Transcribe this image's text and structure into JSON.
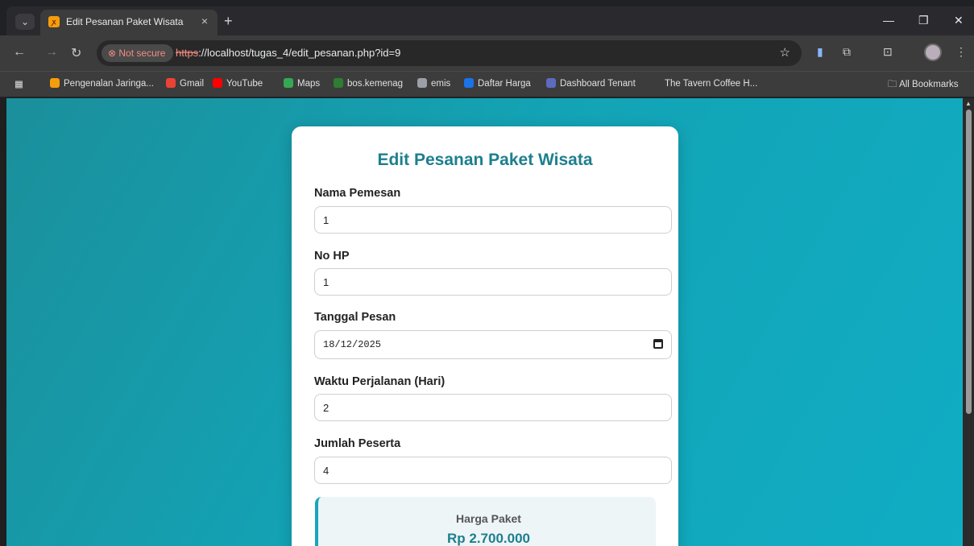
{
  "browser": {
    "tab_title": "Edit Pesanan Paket Wisata",
    "tab_close": "×",
    "new_tab": "+",
    "not_secure": "Not secure",
    "url_scheme": "https",
    "url_rest": "://localhost/tugas_4/edit_pesanan.php?id=9",
    "bookmarks": [
      {
        "label": "Pengenalan Jaringa...",
        "color": "#f59e0b"
      },
      {
        "label": "Gmail",
        "color": "#ea4335"
      },
      {
        "label": "YouTube",
        "color": "#ff0000"
      },
      {
        "label": "Maps",
        "color": "#34a853"
      },
      {
        "label": "bos.kemenag",
        "color": "#2e7d32"
      },
      {
        "label": "emis",
        "color": "#9aa0a6"
      },
      {
        "label": "Daftar Harga",
        "color": "#1a73e8"
      },
      {
        "label": "Dashboard Tenant",
        "color": "#5c6bc0"
      },
      {
        "label": "The Tavern Coffee H...",
        "color": "#3c3c3c"
      }
    ],
    "all_bookmarks": "All Bookmarks"
  },
  "form": {
    "title": "Edit Pesanan Paket Wisata",
    "fields": [
      {
        "label": "Nama Pemesan",
        "value": "1"
      },
      {
        "label": "No HP",
        "value": "1"
      },
      {
        "label": "Tanggal Pesan",
        "value": "18/12/2025"
      },
      {
        "label": "Waktu Perjalanan (Hari)",
        "value": "2"
      },
      {
        "label": "Jumlah Peserta",
        "value": "4"
      }
    ],
    "price_label": "Harga Paket",
    "price_value": "Rp 2.700.000"
  },
  "colors": {
    "accent": "#1d7f8e",
    "background": "#13a3b5"
  }
}
